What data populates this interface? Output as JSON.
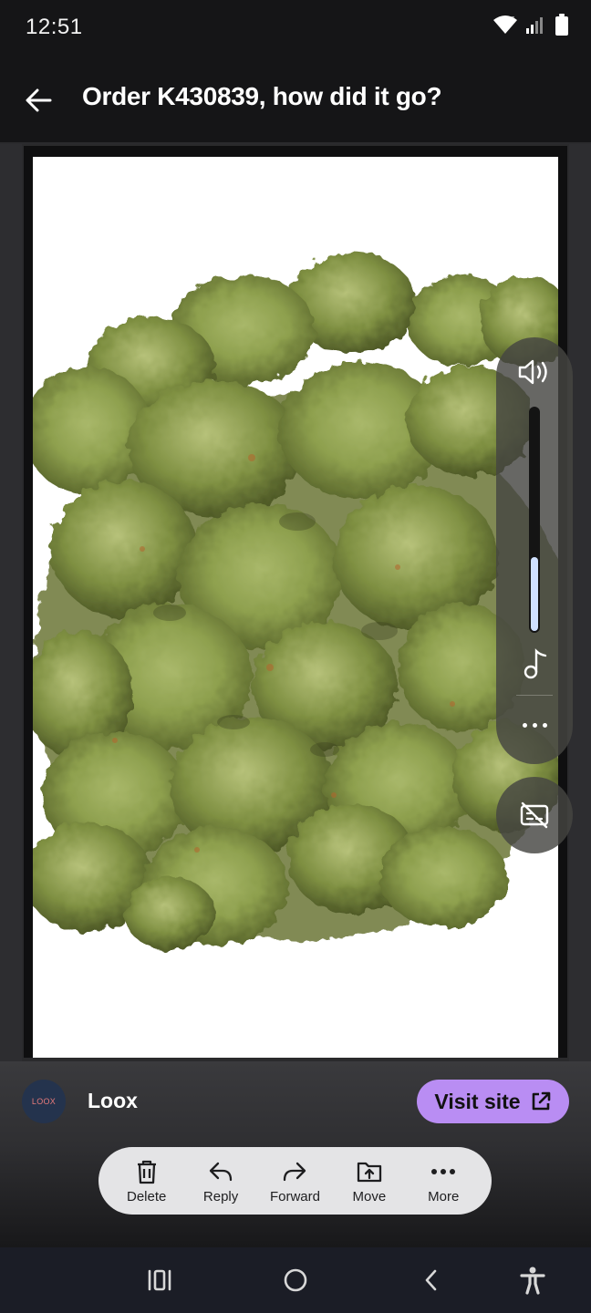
{
  "status_bar": {
    "time": "12:51",
    "icons": [
      "wifi-icon",
      "signal-icon",
      "battery-icon"
    ]
  },
  "header": {
    "title": "Order K430839, how did it go?",
    "back_icon": "arrow-left-icon"
  },
  "media": {
    "image_alt": "cannabis buds photo",
    "volume_level": 0.33
  },
  "sender": {
    "avatar_text": "LOOX",
    "name": "Loox",
    "visit_label": "Visit site"
  },
  "actions": [
    {
      "label": "Delete",
      "icon": "trash-icon"
    },
    {
      "label": "Reply",
      "icon": "reply-icon"
    },
    {
      "label": "Forward",
      "icon": "forward-icon"
    },
    {
      "label": "Move",
      "icon": "move-icon"
    },
    {
      "label": "More",
      "icon": "more-icon"
    }
  ],
  "nav": [
    "recent-apps-icon",
    "home-icon",
    "back-icon",
    "accessibility-icon"
  ],
  "colors": {
    "accent": "#b98df3",
    "background": "#1b1b1d",
    "action_bar": "#e4e4e6",
    "volume_fill": "#cfe0ff"
  }
}
